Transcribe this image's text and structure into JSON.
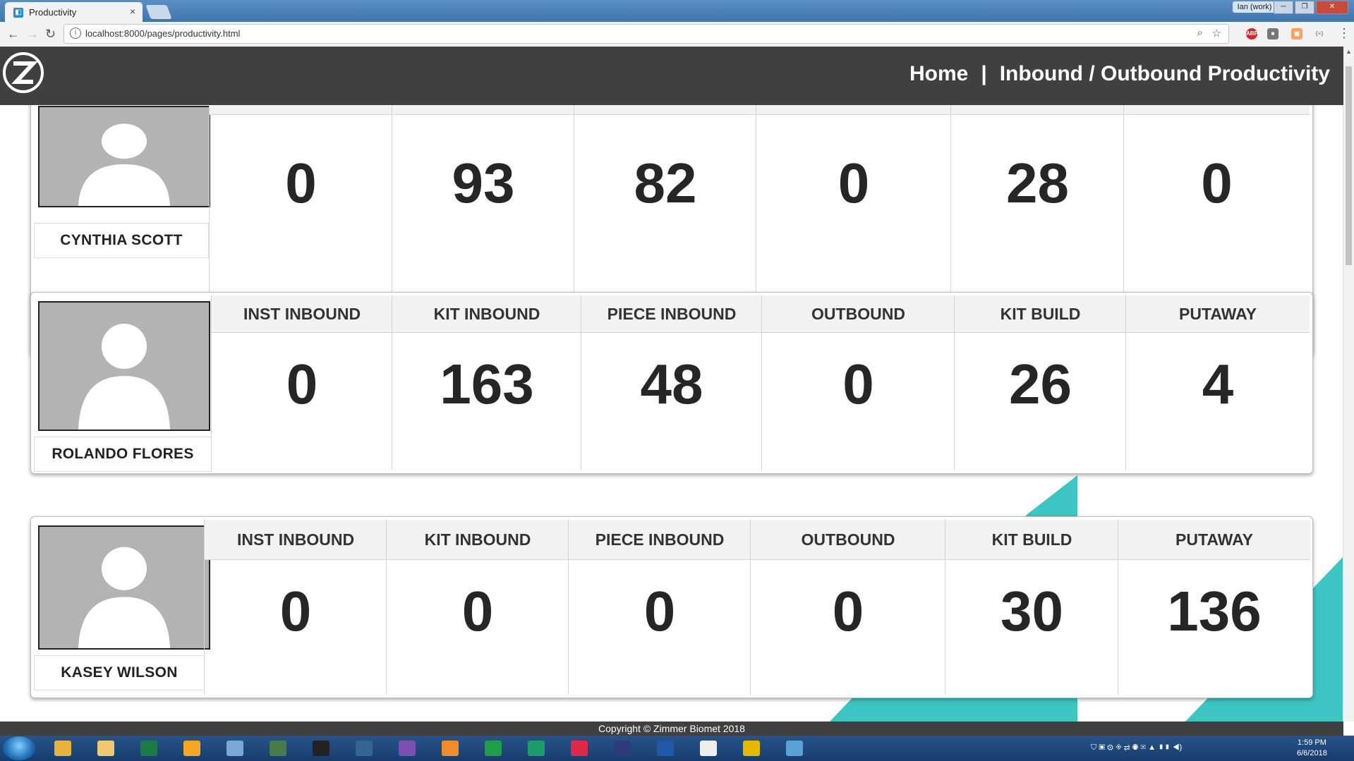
{
  "browser": {
    "tab_title": "Productivity",
    "tab_close": "×",
    "profile_label": "Ian (work)",
    "url": "localhost:8000/pages/productivity.html",
    "window_controls": [
      "─",
      "❐",
      "✕"
    ]
  },
  "header": {
    "logo_letter": "Z",
    "nav_home": "Home",
    "nav_separator": "|",
    "nav_current": "Inbound / Outbound Productivity"
  },
  "columns": [
    "INST INBOUND",
    "KIT INBOUND",
    "PIECE INBOUND",
    "OUTBOUND",
    "KIT BUILD",
    "PUTAWAY"
  ],
  "employees": [
    {
      "name": "CYNTHIA SCOTT",
      "values": [
        "0",
        "93",
        "82",
        "0",
        "28",
        "0"
      ]
    },
    {
      "name": "ROLANDO FLORES",
      "values": [
        "0",
        "163",
        "48",
        "0",
        "26",
        "4"
      ]
    },
    {
      "name": "KASEY WILSON",
      "values": [
        "0",
        "0",
        "0",
        "0",
        "30",
        "136"
      ]
    }
  ],
  "footer": {
    "copyright": "Copyright © Zimmer Biomet 2018"
  },
  "taskbar": {
    "time": "1:59 PM",
    "date": "6/6/2018",
    "apps": [
      "chrome-icon",
      "explorer-icon",
      "excel-icon",
      "outlook-icon",
      "notepad-icon",
      "computer-icon",
      "terminal-icon",
      "postgres-icon",
      "visual-studio-icon",
      "sublime-icon",
      "pycharm-icon",
      "datagrip-icon",
      "intellij-icon",
      "webstorm-icon",
      "powershell-icon",
      "barcode-icon",
      "lock-icon",
      "explorer-window-icon"
    ]
  },
  "colors": {
    "header_bg": "#404040",
    "accent_teal": "#3cc5c2",
    "card_border": "#bdbdbd"
  }
}
